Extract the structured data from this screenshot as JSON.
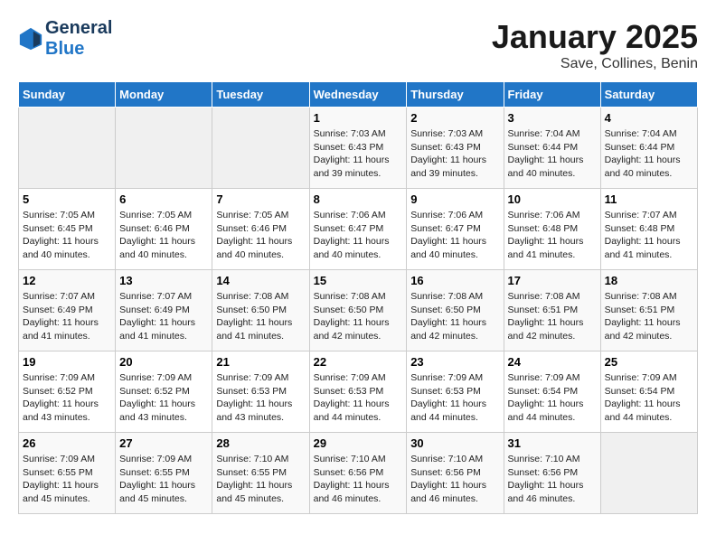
{
  "header": {
    "logo_line1": "General",
    "logo_line2": "Blue",
    "title": "January 2025",
    "subtitle": "Save, Collines, Benin"
  },
  "weekdays": [
    "Sunday",
    "Monday",
    "Tuesday",
    "Wednesday",
    "Thursday",
    "Friday",
    "Saturday"
  ],
  "weeks": [
    [
      {
        "day": "",
        "info": ""
      },
      {
        "day": "",
        "info": ""
      },
      {
        "day": "",
        "info": ""
      },
      {
        "day": "1",
        "info": "Sunrise: 7:03 AM\nSunset: 6:43 PM\nDaylight: 11 hours\nand 39 minutes."
      },
      {
        "day": "2",
        "info": "Sunrise: 7:03 AM\nSunset: 6:43 PM\nDaylight: 11 hours\nand 39 minutes."
      },
      {
        "day": "3",
        "info": "Sunrise: 7:04 AM\nSunset: 6:44 PM\nDaylight: 11 hours\nand 40 minutes."
      },
      {
        "day": "4",
        "info": "Sunrise: 7:04 AM\nSunset: 6:44 PM\nDaylight: 11 hours\nand 40 minutes."
      }
    ],
    [
      {
        "day": "5",
        "info": "Sunrise: 7:05 AM\nSunset: 6:45 PM\nDaylight: 11 hours\nand 40 minutes."
      },
      {
        "day": "6",
        "info": "Sunrise: 7:05 AM\nSunset: 6:46 PM\nDaylight: 11 hours\nand 40 minutes."
      },
      {
        "day": "7",
        "info": "Sunrise: 7:05 AM\nSunset: 6:46 PM\nDaylight: 11 hours\nand 40 minutes."
      },
      {
        "day": "8",
        "info": "Sunrise: 7:06 AM\nSunset: 6:47 PM\nDaylight: 11 hours\nand 40 minutes."
      },
      {
        "day": "9",
        "info": "Sunrise: 7:06 AM\nSunset: 6:47 PM\nDaylight: 11 hours\nand 40 minutes."
      },
      {
        "day": "10",
        "info": "Sunrise: 7:06 AM\nSunset: 6:48 PM\nDaylight: 11 hours\nand 41 minutes."
      },
      {
        "day": "11",
        "info": "Sunrise: 7:07 AM\nSunset: 6:48 PM\nDaylight: 11 hours\nand 41 minutes."
      }
    ],
    [
      {
        "day": "12",
        "info": "Sunrise: 7:07 AM\nSunset: 6:49 PM\nDaylight: 11 hours\nand 41 minutes."
      },
      {
        "day": "13",
        "info": "Sunrise: 7:07 AM\nSunset: 6:49 PM\nDaylight: 11 hours\nand 41 minutes."
      },
      {
        "day": "14",
        "info": "Sunrise: 7:08 AM\nSunset: 6:50 PM\nDaylight: 11 hours\nand 41 minutes."
      },
      {
        "day": "15",
        "info": "Sunrise: 7:08 AM\nSunset: 6:50 PM\nDaylight: 11 hours\nand 42 minutes."
      },
      {
        "day": "16",
        "info": "Sunrise: 7:08 AM\nSunset: 6:50 PM\nDaylight: 11 hours\nand 42 minutes."
      },
      {
        "day": "17",
        "info": "Sunrise: 7:08 AM\nSunset: 6:51 PM\nDaylight: 11 hours\nand 42 minutes."
      },
      {
        "day": "18",
        "info": "Sunrise: 7:08 AM\nSunset: 6:51 PM\nDaylight: 11 hours\nand 42 minutes."
      }
    ],
    [
      {
        "day": "19",
        "info": "Sunrise: 7:09 AM\nSunset: 6:52 PM\nDaylight: 11 hours\nand 43 minutes."
      },
      {
        "day": "20",
        "info": "Sunrise: 7:09 AM\nSunset: 6:52 PM\nDaylight: 11 hours\nand 43 minutes."
      },
      {
        "day": "21",
        "info": "Sunrise: 7:09 AM\nSunset: 6:53 PM\nDaylight: 11 hours\nand 43 minutes."
      },
      {
        "day": "22",
        "info": "Sunrise: 7:09 AM\nSunset: 6:53 PM\nDaylight: 11 hours\nand 44 minutes."
      },
      {
        "day": "23",
        "info": "Sunrise: 7:09 AM\nSunset: 6:53 PM\nDaylight: 11 hours\nand 44 minutes."
      },
      {
        "day": "24",
        "info": "Sunrise: 7:09 AM\nSunset: 6:54 PM\nDaylight: 11 hours\nand 44 minutes."
      },
      {
        "day": "25",
        "info": "Sunrise: 7:09 AM\nSunset: 6:54 PM\nDaylight: 11 hours\nand 44 minutes."
      }
    ],
    [
      {
        "day": "26",
        "info": "Sunrise: 7:09 AM\nSunset: 6:55 PM\nDaylight: 11 hours\nand 45 minutes."
      },
      {
        "day": "27",
        "info": "Sunrise: 7:09 AM\nSunset: 6:55 PM\nDaylight: 11 hours\nand 45 minutes."
      },
      {
        "day": "28",
        "info": "Sunrise: 7:10 AM\nSunset: 6:55 PM\nDaylight: 11 hours\nand 45 minutes."
      },
      {
        "day": "29",
        "info": "Sunrise: 7:10 AM\nSunset: 6:56 PM\nDaylight: 11 hours\nand 46 minutes."
      },
      {
        "day": "30",
        "info": "Sunrise: 7:10 AM\nSunset: 6:56 PM\nDaylight: 11 hours\nand 46 minutes."
      },
      {
        "day": "31",
        "info": "Sunrise: 7:10 AM\nSunset: 6:56 PM\nDaylight: 11 hours\nand 46 minutes."
      },
      {
        "day": "",
        "info": ""
      }
    ]
  ]
}
